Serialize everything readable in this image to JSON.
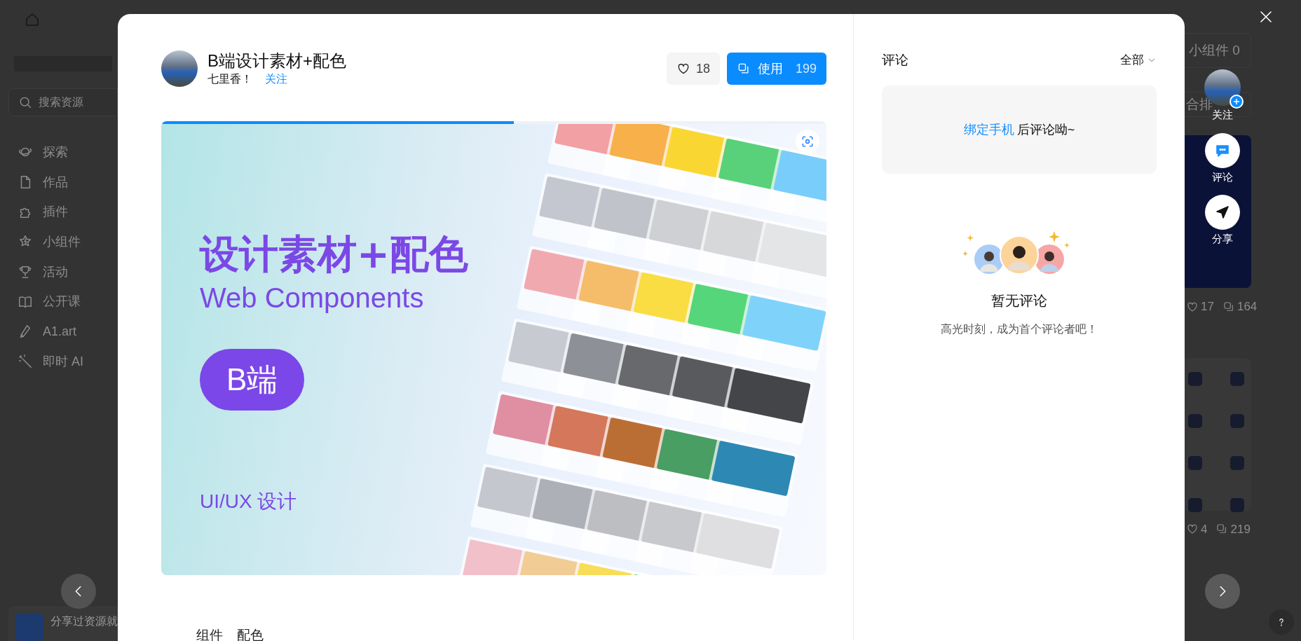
{
  "sidebar": {
    "search": {
      "placeholder": "搜索资源"
    },
    "items": [
      {
        "label": "探索"
      },
      {
        "label": "作品"
      },
      {
        "label": "插件"
      },
      {
        "label": "小组件"
      },
      {
        "label": "活动"
      },
      {
        "label": "公开课"
      },
      {
        "label": "A1.art"
      },
      {
        "label": "即时 AI"
      }
    ],
    "promo_card": {
      "title": "分享过资源就"
    }
  },
  "background": {
    "tabs": [
      {
        "label": "小组件 0"
      },
      {
        "label": "合排"
      }
    ],
    "cards": [
      {
        "likes": "17",
        "uses": "164"
      },
      {
        "likes": "4",
        "uses": "219"
      }
    ]
  },
  "modal": {
    "title": "B端设计素材+配色",
    "author": "七里香！",
    "follow": "关注",
    "likes": "18",
    "use": {
      "label": "使用",
      "count": "199"
    },
    "preview": {
      "level": 0.53,
      "headline": "设计素材+配色",
      "subtitle": "Web Components",
      "badge": "B端",
      "footer": "UI/UX 设计"
    },
    "tags": [
      "组件",
      "配色"
    ],
    "comments": {
      "title": "评论",
      "filter": "全部",
      "prompt": {
        "link": "绑定手机",
        "text": "后评论呦~"
      },
      "empty": {
        "title": "暂无评论",
        "subtitle": "高光时刻，成为首个评论者吧！"
      }
    }
  },
  "side_actions": [
    {
      "label": "关注"
    },
    {
      "label": "评论"
    },
    {
      "label": "分享"
    }
  ]
}
